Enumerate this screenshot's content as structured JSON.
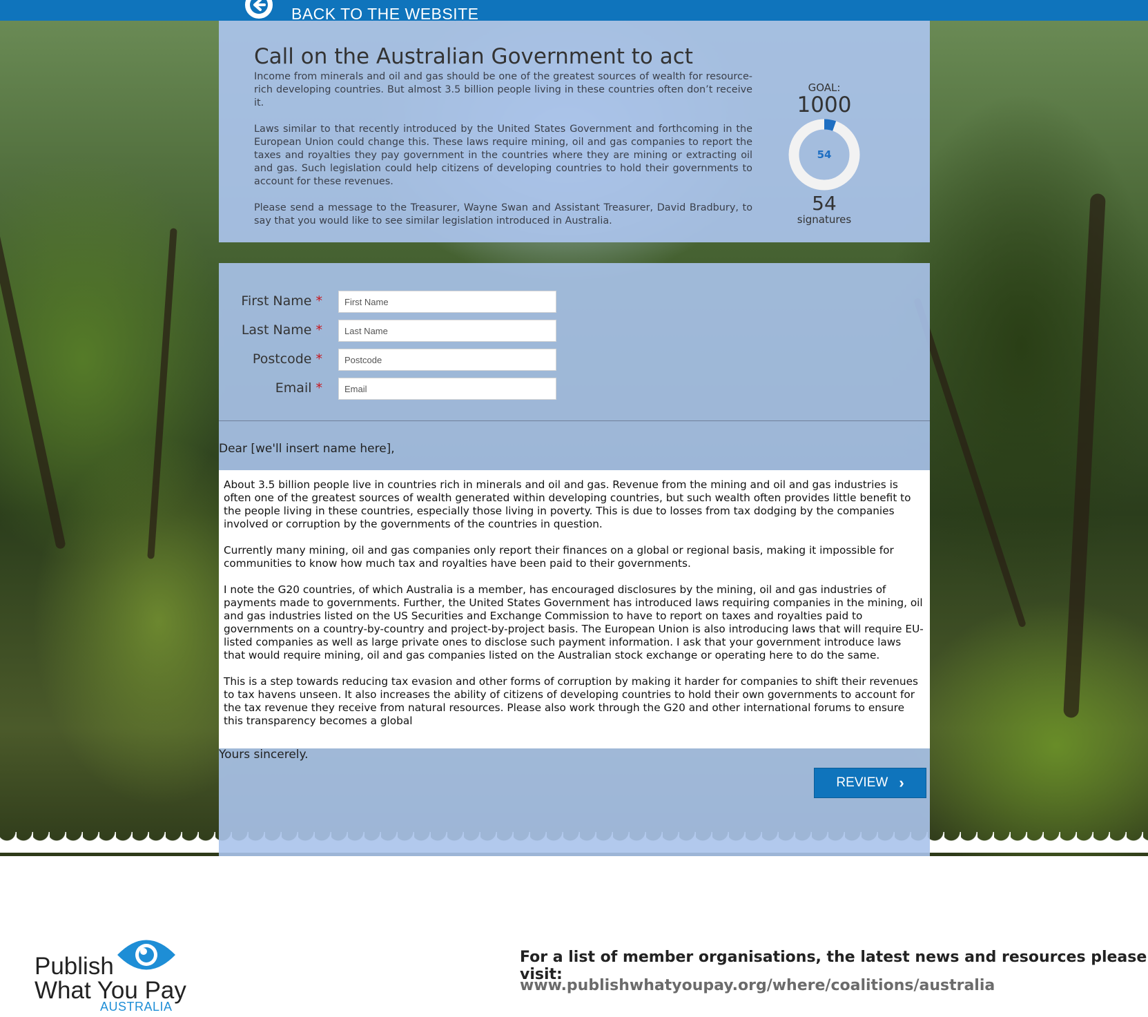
{
  "topbar": {
    "back_label": "BACK TO THE WEBSITE",
    "color": "#0f74bc"
  },
  "intro": {
    "title": "Call on the Australian Government to act",
    "paragraphs": [
      "Income from minerals and oil and gas should be one of the greatest sources of wealth for resource-rich developing countries. But almost 3.5 billion people living in these countries often don’t receive it.",
      "Laws similar to that recently introduced by the United States Government and forthcoming in the European Union could change this. These laws require mining, oil and gas companies to report the taxes and royalties they pay government in the countries where they are mining or extracting oil and gas. Such legislation could help citizens of developing countries to hold their governments to account for these revenues.",
      "Please send a message to the Treasurer, Wayne Swan and Assistant Treasurer, David Bradbury, to say that you would like to see similar legislation introduced in Australia."
    ]
  },
  "goal": {
    "label": "GOAL:",
    "target": "1000",
    "donut_count": "54",
    "signatures": "54",
    "signatures_label": "signatures",
    "progress_fraction": 0.054,
    "accent": "#1f6fc2"
  },
  "form": {
    "required_mark": "*",
    "fields": [
      {
        "label": "First Name",
        "placeholder": "First Name",
        "value": ""
      },
      {
        "label": "Last Name",
        "placeholder": "Last Name",
        "value": ""
      },
      {
        "label": "Postcode",
        "placeholder": "Postcode",
        "value": ""
      },
      {
        "label": "Email",
        "placeholder": "Email",
        "value": ""
      }
    ]
  },
  "letter": {
    "salutation": "Dear [we'll insert name here],",
    "paragraphs": [
      "About 3.5 billion people live in countries rich in minerals and oil and gas.  Revenue from the mining and oil and gas industries is often one of the greatest sources of wealth generated within developing countries, but such wealth often provides little benefit to the people living in these countries, especially those living in poverty. This is due to losses from tax dodging by the companies involved or corruption by the governments of the countries in question.",
      "Currently many mining, oil and gas companies only report their finances on a global or regional basis, making it impossible for communities to know how much tax and royalties have been paid to their governments.",
      "I note the G20 countries, of which Australia is a member, has encouraged disclosures by the mining, oil and gas industries of payments made to governments. Further, the United States Government has introduced laws requiring companies in the mining, oil and gas industries listed on the US Securities and Exchange Commission to have to report on taxes and royalties paid to governments on a country-by-country and project-by-project basis. The European Union is also introducing laws that will require EU-listed companies as well as large private ones to disclose such payment information. I ask that your government introduce laws that would require mining, oil and gas companies listed on the Australian stock exchange or operating here to do the same.",
      "This is a step towards reducing tax evasion and other forms of corruption by making it harder for companies to shift their revenues to tax havens unseen. It also increases the ability of citizens of developing countries to hold their own governments to account for the tax revenue they receive from natural resources. Please also work through the G20 and other international forums to ensure this transparency becomes a global"
    ],
    "closing": "Yours sincerely.",
    "review_label": "REVIEW"
  },
  "footer": {
    "logo_line1": "Publish",
    "logo_line2": "What You Pay",
    "logo_sub": "AUSTRALIA",
    "info_text": "For a list of member organisations, the latest news and resources please visit:",
    "link": "www.publishwhatyoupay.org/where/coalitions/australia"
  }
}
